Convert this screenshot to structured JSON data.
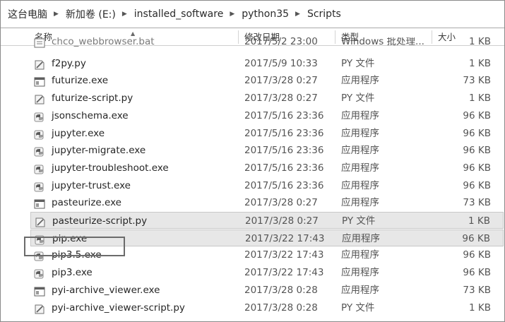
{
  "breadcrumb": {
    "items": [
      "这台电脑",
      "新加卷 (E:)",
      "installed_software",
      "python35",
      "Scripts"
    ]
  },
  "columns": {
    "name": "名称",
    "date": "修改日期",
    "type": "类型",
    "size": "大小"
  },
  "files": [
    {
      "name": "chco_webbrowser.bat",
      "date": "2017/5/2 23:00",
      "type": "Windows 批处理...",
      "size": "1 KB",
      "icon": "batch-file-icon"
    },
    {
      "name": "f2py.py",
      "date": "2017/5/9 10:33",
      "type": "PY 文件",
      "size": "1 KB",
      "icon": "python-file-icon"
    },
    {
      "name": "futurize.exe",
      "date": "2017/3/28 0:27",
      "type": "应用程序",
      "size": "73 KB",
      "icon": "application-window-icon"
    },
    {
      "name": "futurize-script.py",
      "date": "2017/3/28 0:27",
      "type": "PY 文件",
      "size": "1 KB",
      "icon": "python-file-icon"
    },
    {
      "name": "jsonschema.exe",
      "date": "2017/5/16 23:36",
      "type": "应用程序",
      "size": "96 KB",
      "icon": "python-exe-icon"
    },
    {
      "name": "jupyter.exe",
      "date": "2017/5/16 23:36",
      "type": "应用程序",
      "size": "96 KB",
      "icon": "python-exe-icon"
    },
    {
      "name": "jupyter-migrate.exe",
      "date": "2017/5/16 23:36",
      "type": "应用程序",
      "size": "96 KB",
      "icon": "python-exe-icon"
    },
    {
      "name": "jupyter-troubleshoot.exe",
      "date": "2017/5/16 23:36",
      "type": "应用程序",
      "size": "96 KB",
      "icon": "python-exe-icon"
    },
    {
      "name": "jupyter-trust.exe",
      "date": "2017/5/16 23:36",
      "type": "应用程序",
      "size": "96 KB",
      "icon": "python-exe-icon"
    },
    {
      "name": "pasteurize.exe",
      "date": "2017/3/28 0:27",
      "type": "应用程序",
      "size": "73 KB",
      "icon": "application-window-icon"
    },
    {
      "name": "pasteurize-script.py",
      "date": "2017/3/28 0:27",
      "type": "PY 文件",
      "size": "1 KB",
      "icon": "python-file-icon"
    },
    {
      "name": "pip.exe",
      "date": "2017/3/22 17:43",
      "type": "应用程序",
      "size": "96 KB",
      "icon": "python-exe-icon"
    },
    {
      "name": "pip3.5.exe",
      "date": "2017/3/22 17:43",
      "type": "应用程序",
      "size": "96 KB",
      "icon": "python-exe-icon"
    },
    {
      "name": "pip3.exe",
      "date": "2017/3/22 17:43",
      "type": "应用程序",
      "size": "96 KB",
      "icon": "python-exe-icon"
    },
    {
      "name": "pyi-archive_viewer.exe",
      "date": "2017/3/28 0:28",
      "type": "应用程序",
      "size": "73 KB",
      "icon": "application-window-icon"
    },
    {
      "name": "pyi-archive_viewer-script.py",
      "date": "2017/3/28 0:28",
      "type": "PY 文件",
      "size": "1 KB",
      "icon": "python-file-icon"
    }
  ],
  "selected_file": "pip.exe"
}
